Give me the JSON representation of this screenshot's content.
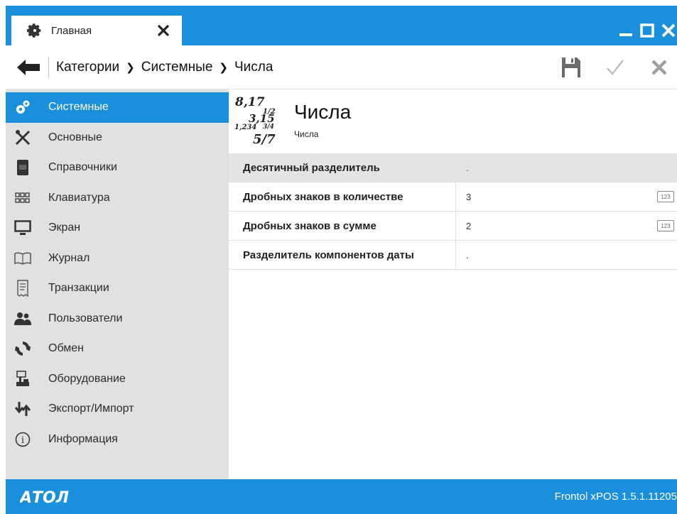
{
  "titlebar": {
    "tab_label": "Главная",
    "tab_icon": "gear-icon",
    "window_controls": [
      "minimize-icon",
      "maximize-icon",
      "close-icon"
    ],
    "accent_color": "#1a8fdb"
  },
  "toolbar": {
    "breadcrumb": [
      "Категории",
      "Системные",
      "Числа"
    ],
    "actions": [
      "save-icon",
      "apply-check-icon",
      "cancel-x-icon"
    ]
  },
  "sidebar": {
    "active_index": 0,
    "items": [
      {
        "label": "Системные",
        "icon": "gears-icon"
      },
      {
        "label": "Основные",
        "icon": "tools-icon"
      },
      {
        "label": "Справочники",
        "icon": "book-icon"
      },
      {
        "label": "Клавиатура",
        "icon": "keyboard-icon"
      },
      {
        "label": "Экран",
        "icon": "monitor-icon"
      },
      {
        "label": "Журнал",
        "icon": "journal-icon"
      },
      {
        "label": "Транзакции",
        "icon": "receipt-icon"
      },
      {
        "label": "Пользователи",
        "icon": "users-icon"
      },
      {
        "label": "Обмен",
        "icon": "exchange-icon"
      },
      {
        "label": "Оборудование",
        "icon": "equipment-icon"
      },
      {
        "label": "Экспорт/Импорт",
        "icon": "export-import-icon"
      },
      {
        "label": "Информация",
        "icon": "info-icon"
      }
    ]
  },
  "page": {
    "icon_numbers": [
      "8,17",
      "1/2",
      "3,15",
      "1,234",
      "3/4",
      "5/7"
    ],
    "title": "Числа",
    "subtitle": "Числа"
  },
  "settings": [
    {
      "label": "Десятичный разделитель",
      "value": ".",
      "numeric": false,
      "selected": true
    },
    {
      "label": "Дробных знаков в количестве",
      "value": "3",
      "numeric": true,
      "selected": false
    },
    {
      "label": "Дробных знаков в сумме",
      "value": "2",
      "numeric": true,
      "selected": false
    },
    {
      "label": "Разделитель компонентов даты",
      "value": ".",
      "numeric": false,
      "selected": false
    }
  ],
  "numeric_badge": "123",
  "status": {
    "logo": "АТОЛ",
    "version": "Frontol xPOS 1.5.1.11205"
  }
}
